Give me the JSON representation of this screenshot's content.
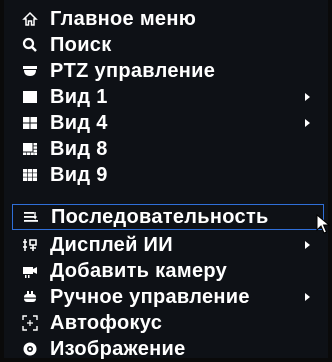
{
  "menu": {
    "items": [
      {
        "label": "Главное меню",
        "icon": "home-icon"
      },
      {
        "label": "Поиск",
        "icon": "search-icon"
      },
      {
        "label": "PTZ управление",
        "icon": "ptz-camera-icon"
      },
      {
        "label": "Вид 1",
        "icon": "single-view-icon",
        "submenu": true
      },
      {
        "label": "Вид 4",
        "icon": "quad-view-icon",
        "submenu": true
      },
      {
        "label": "Вид 8",
        "icon": "eight-view-icon"
      },
      {
        "label": "Вид 9",
        "icon": "nine-view-icon"
      },
      {
        "label": "Последовательность",
        "icon": "sequence-icon",
        "active": true
      },
      {
        "label": "Дисплей ИИ",
        "icon": "ai-display-icon",
        "submenu": true
      },
      {
        "label": "Добавить камеру",
        "icon": "add-camera-icon"
      },
      {
        "label": "Ручное управление",
        "icon": "manual-control-icon",
        "submenu": true
      },
      {
        "label": "Автофокус",
        "icon": "autofocus-icon"
      },
      {
        "label": "Изображение",
        "icon": "image-icon"
      }
    ]
  },
  "colors": {
    "background": "#0e1116",
    "text": "#ffffff",
    "active_border": "#2f6fd8"
  }
}
